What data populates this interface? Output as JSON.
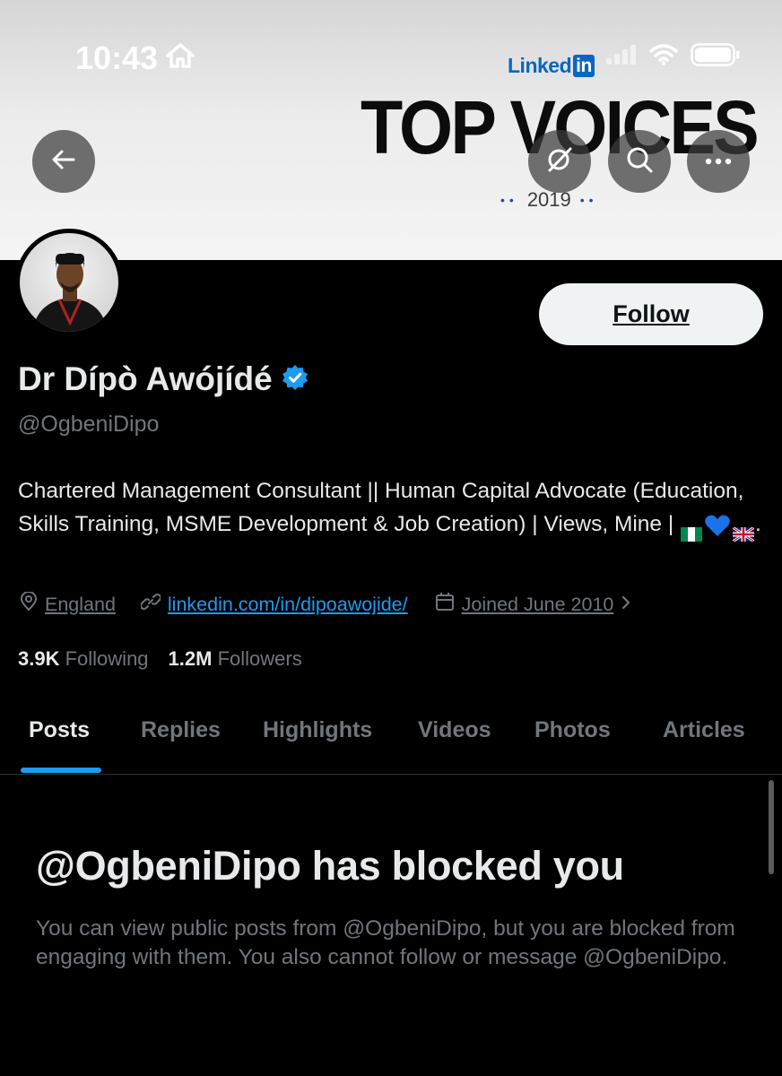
{
  "status_bar": {
    "time": "10:43"
  },
  "banner": {
    "logo_text": "Linked",
    "logo_in": "in",
    "headline": "TOP VOICES",
    "year": "2019"
  },
  "header_buttons": {
    "back": "arrow-left-icon",
    "grok": "grok-icon",
    "search": "search-icon",
    "more": "more-icon"
  },
  "profile": {
    "follow_label": "Follow",
    "name": "Dr Dípò Awójídé",
    "handle": "@OgbeniDipo",
    "bio_text": "Chartered Management Consultant || Human Capital Advocate (Education, Skills Training, MSME Development & Job Creation) | Views, Mine | ",
    "bio_end": ".",
    "location": "England",
    "website": "linkedin.com/in/dipoawojide/",
    "joined": "Joined June 2010",
    "following_count": "3.9K",
    "following_label": "Following",
    "followers_count": "1.2M",
    "followers_label": "Followers"
  },
  "tabs": [
    {
      "label": "Posts"
    },
    {
      "label": "Replies"
    },
    {
      "label": "Highlights"
    },
    {
      "label": "Videos"
    },
    {
      "label": "Photos"
    },
    {
      "label": "Articles"
    }
  ],
  "blocked": {
    "title": "@OgbeniDipo has blocked you",
    "message": "You can view public posts from @OgbeniDipo, but you are blocked from engaging with them. You also cannot follow or message @OgbeniDipo."
  },
  "colors": {
    "accent": "#1d9bf0",
    "verified": "#1d9bf0",
    "muted_text": "#71767b",
    "background": "#000000"
  }
}
